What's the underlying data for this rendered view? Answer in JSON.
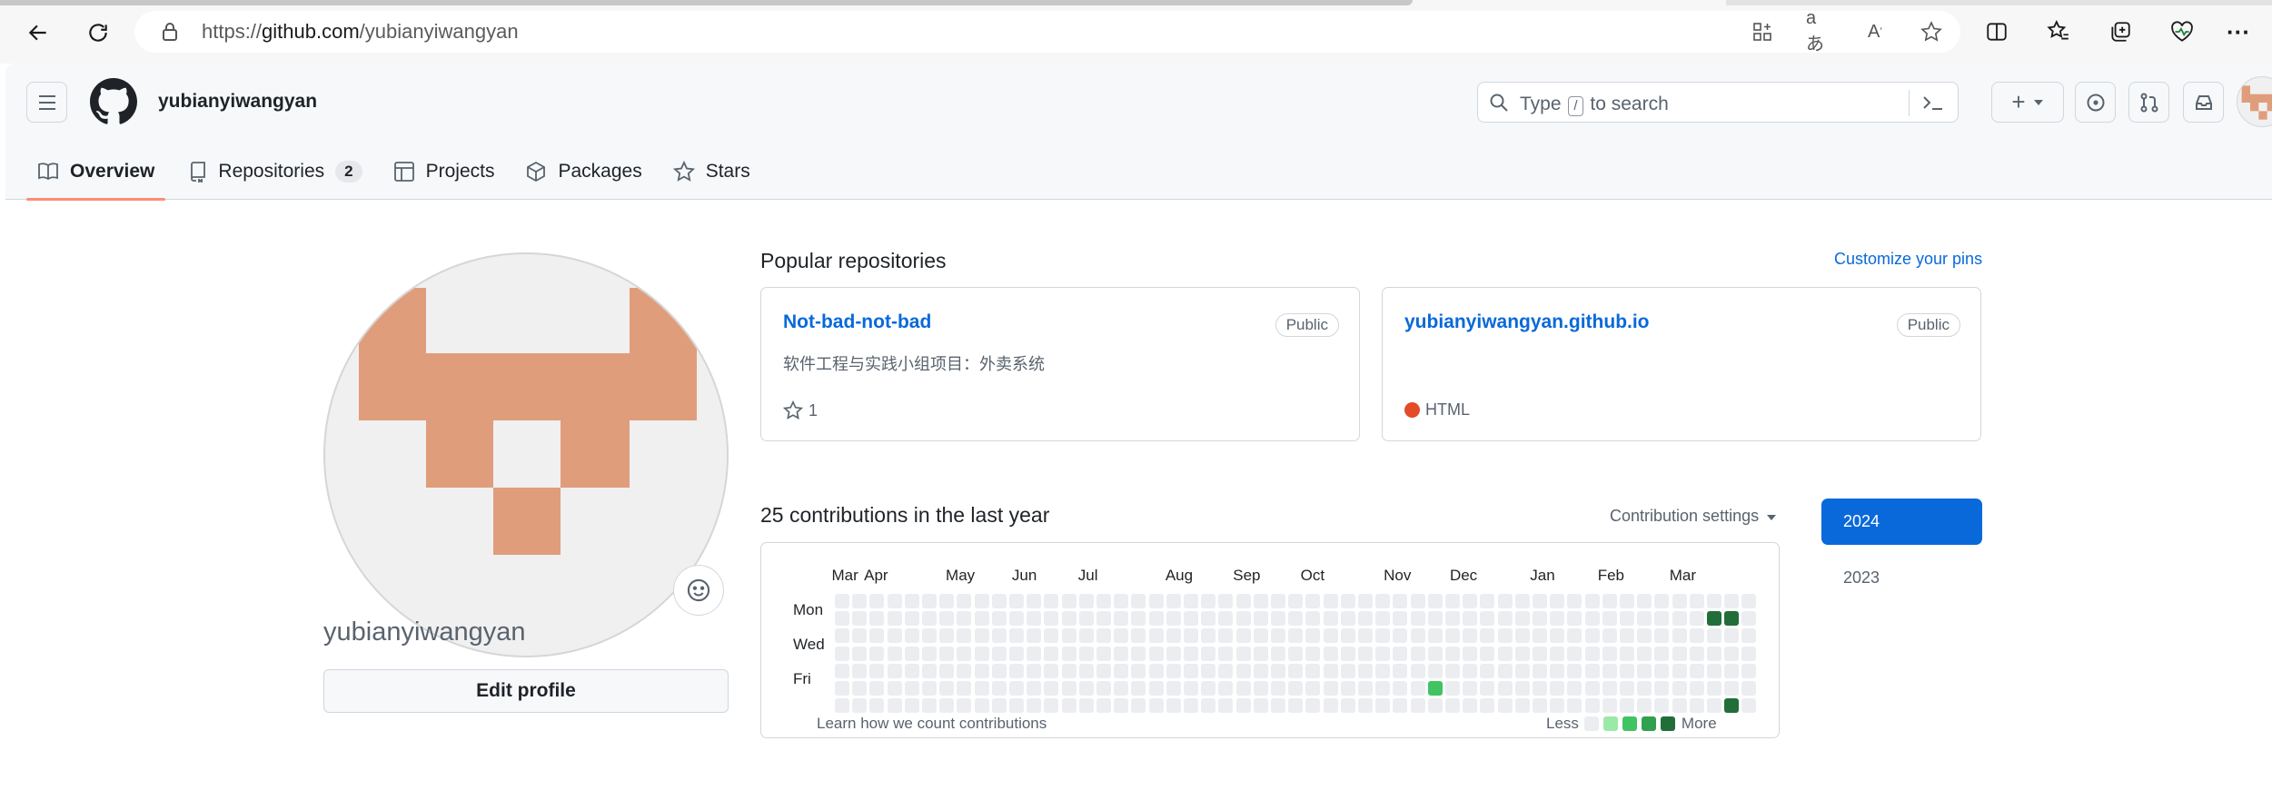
{
  "browser": {
    "url_prefix": "https://",
    "url_host": "github.com",
    "url_path": "/yubianyiwangyan",
    "icons": [
      "back-icon",
      "refresh-icon",
      "lock-icon",
      "apps-icon",
      "translate-icon",
      "read-aloud-icon",
      "favorite-star-icon",
      "split-screen-icon",
      "favorites-icon",
      "collections-icon",
      "performance-icon",
      "more-icon"
    ]
  },
  "header": {
    "username": "yubianyiwangyan",
    "search_prefix": "Type",
    "search_key": "/",
    "search_suffix": "to search",
    "plus_label": "+"
  },
  "tabs": [
    {
      "label": "Overview",
      "icon": "book-icon"
    },
    {
      "label": "Repositories",
      "icon": "repo-icon",
      "count": "2"
    },
    {
      "label": "Projects",
      "icon": "table-icon"
    },
    {
      "label": "Packages",
      "icon": "package-icon"
    },
    {
      "label": "Stars",
      "icon": "star-icon"
    }
  ],
  "profile": {
    "username": "yubianyiwangyan",
    "edit_label": "Edit profile",
    "avatar_color": "#e09d7c"
  },
  "popular": {
    "title": "Popular repositories",
    "customize_label": "Customize your pins",
    "repos": [
      {
        "name": "Not-bad-not-bad",
        "visibility": "Public",
        "description": "软件工程与实践小组项目：外卖系统",
        "stars": "1"
      },
      {
        "name": "yubianyiwangyan.github.io",
        "visibility": "Public",
        "language": "HTML",
        "language_color": "#e34c26"
      }
    ]
  },
  "contributions": {
    "title": "25 contributions in the last year",
    "settings_label": "Contribution settings",
    "months": [
      "Mar",
      "Apr",
      "May",
      "Jun",
      "Jul",
      "Aug",
      "Sep",
      "Oct",
      "Nov",
      "Dec",
      "Jan",
      "Feb",
      "Mar"
    ],
    "days": [
      "Mon",
      "Wed",
      "Fri"
    ],
    "learn_label": "Learn how we count contributions",
    "less_label": "Less",
    "more_label": "More",
    "colors": [
      "#ebedf0",
      "#9be9a8",
      "#40c463",
      "#30a14e",
      "#216e39"
    ],
    "active_cells": [
      {
        "week": 34,
        "day": 5,
        "level": 2
      },
      {
        "week": 50,
        "day": 1,
        "level": 4
      },
      {
        "week": 51,
        "day": 1,
        "level": 4
      },
      {
        "week": 51,
        "day": 6,
        "level": 4
      }
    ]
  },
  "years": [
    "2024",
    "2023"
  ]
}
